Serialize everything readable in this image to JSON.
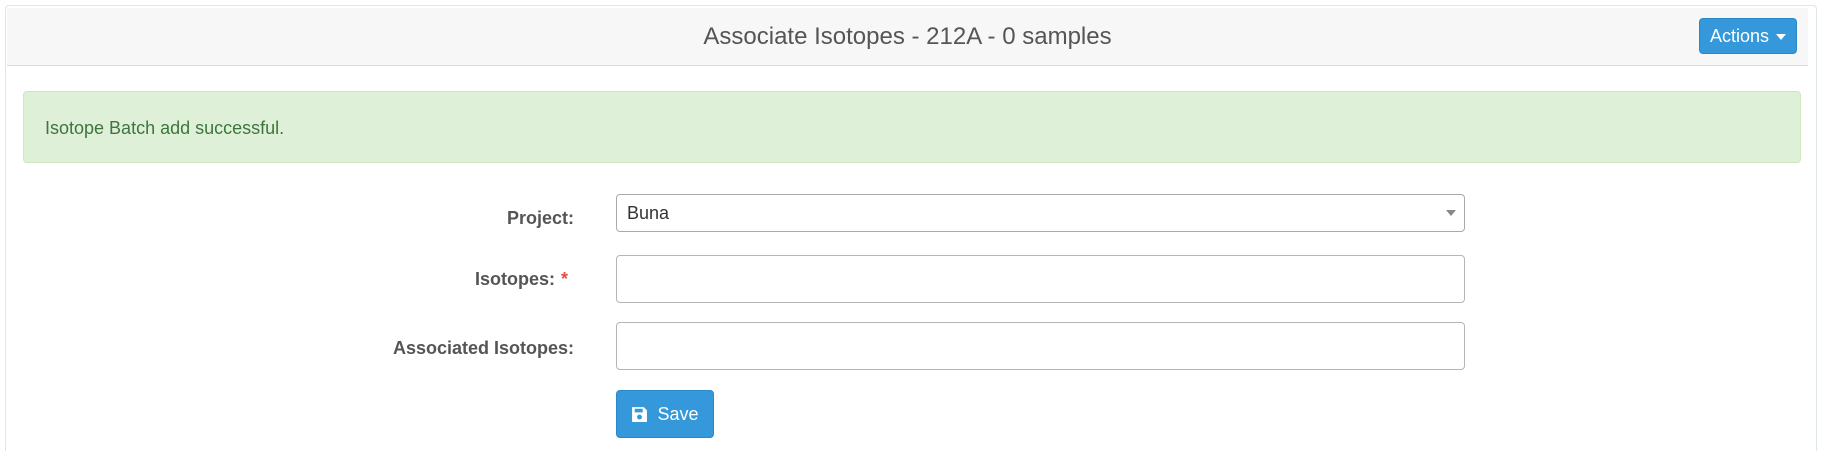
{
  "panel": {
    "title": "Associate Isotopes - 212A - 0 samples",
    "actions_label": "Actions"
  },
  "alert": {
    "message": "Isotope Batch add successful."
  },
  "form": {
    "project": {
      "label": "Project:",
      "selected_value": "Buna"
    },
    "isotopes": {
      "label": "Isotopes:",
      "required_marker": "*",
      "value": ""
    },
    "associated_isotopes": {
      "label": "Associated Isotopes:",
      "value": ""
    },
    "save_label": "Save"
  },
  "icons": {
    "actions_dropdown": "caret-down-icon",
    "project_select": "caret-down-icon",
    "save": "floppy-disk-icon"
  },
  "colors": {
    "primary": "#3498db",
    "success_bg": "#dff0d8",
    "success_text": "#3c763d",
    "required": "#e74c3c"
  }
}
